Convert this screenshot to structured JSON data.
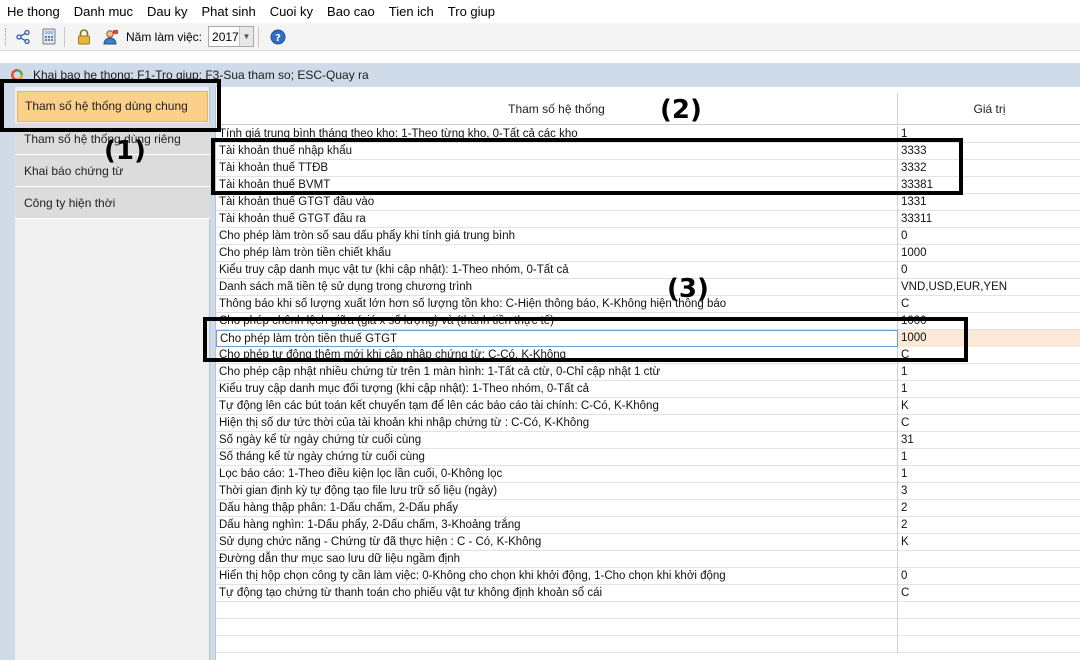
{
  "menu": [
    "He thong",
    "Danh muc",
    "Dau ky",
    "Phat sinh",
    "Cuoi ky",
    "Bao cao",
    "Tien ich",
    "Tro giup"
  ],
  "toolbar": {
    "icons": [
      "share-icon",
      "calculator-icon",
      "lock-icon",
      "user-icon",
      "help-icon"
    ],
    "year_label": "Năm làm việc:",
    "year_value": "2017"
  },
  "window": {
    "title": "Khai bao he thong: F1-Tro giup; F3-Sua tham so; ESC-Quay ra"
  },
  "sidebar": {
    "items": [
      {
        "label": "Tham số hệ thống dùng chung",
        "active": true
      },
      {
        "label": "Tham số hệ thống dùng riêng",
        "active": false
      },
      {
        "label": "Khai báo chứng từ",
        "active": false
      },
      {
        "label": "Công ty hiện thời",
        "active": false
      }
    ]
  },
  "grid": {
    "columns": {
      "name": "Tham số hệ thống",
      "value": "Giá trị"
    },
    "rows": [
      {
        "name": "Tính giá trung bình tháng theo kho: 1-Theo từng kho, 0-Tất cả các kho",
        "value": "1"
      },
      {
        "name": "Tài khoản thuế nhập khẩu",
        "value": "3333"
      },
      {
        "name": "Tài khoản thuế TTĐB",
        "value": "3332"
      },
      {
        "name": "Tài khoản thuế BVMT",
        "value": "33381"
      },
      {
        "name": "Tài khoản thuế GTGT đầu vào",
        "value": "1331"
      },
      {
        "name": "Tài khoản thuế GTGT đầu ra",
        "value": "33311"
      },
      {
        "name": "Cho phép làm tròn số sau dấu phẩy khi tính giá trung bình",
        "value": "0"
      },
      {
        "name": "Cho phép làm tròn tiền chiết khấu",
        "value": "1000"
      },
      {
        "name": "Kiểu truy cập danh mục vật tư (khi cập nhật): 1-Theo nhóm, 0-Tất cả",
        "value": "0"
      },
      {
        "name": "Danh sách mã tiền tệ sử dụng trong chương trình",
        "value": "VND,USD,EUR,YEN"
      },
      {
        "name": "Thông báo khi số lượng xuất lớn hơn số lượng tồn kho: C-Hiện thông báo,   K-Không hiện thông báo",
        "value": "C"
      },
      {
        "name": "Cho phép chênh lệch giữa (giá x số lượng) và (thành tiền thực tế)",
        "value": "1000"
      },
      {
        "name": "Cho phép làm tròn tiền thuế GTGT",
        "value": "1000"
      },
      {
        "name": "Cho phép tự động thêm mới khi cập nhập chứng từ: C-Có, K-Không",
        "value": "C"
      },
      {
        "name": "Cho phép cập nhật nhiều chứng từ trên 1 màn hình: 1-Tất cả ctừ, 0-Chỉ cập nhật 1 ctừ",
        "value": "1"
      },
      {
        "name": "Kiểu truy cập danh mục đối tượng (khi cập nhật): 1-Theo nhóm, 0-Tất cả",
        "value": "1"
      },
      {
        "name": "Tự động lên các bút toán kết chuyển tạm để lên các báo cáo tài chính: C-Có, K-Không",
        "value": "K"
      },
      {
        "name": "Hiện thị số dư tức thời của tài khoản khi  nhập chứng từ : C-Có, K-Không",
        "value": "C"
      },
      {
        "name": "Số ngày kể từ ngày chứng từ cuối cùng",
        "value": "31"
      },
      {
        "name": "Số tháng kể từ ngày chứng từ cuối cùng",
        "value": "1"
      },
      {
        "name": "Lọc báo cáo: 1-Theo điều kiện lọc lần cuối, 0-Không lọc",
        "value": "1"
      },
      {
        "name": "Thời gian định kỳ tự động tạo file lưu trữ số liệu (ngày)",
        "value": "3"
      },
      {
        "name": "Dấu hàng thập phân: 1-Dấu chấm,   2-Dấu phẩy",
        "value": "2"
      },
      {
        "name": "Dấu hàng nghìn: 1-Dấu phẩy,   2-Dấu chấm,   3-Khoảng trắng",
        "value": "2"
      },
      {
        "name": "Sử dụng chức năng - Chứng từ đã thực hiện : C - Có,  K-Không",
        "value": "K"
      },
      {
        "name": "Đường dẫn thư mục sao lưu dữ liệu ngầm định",
        "value": ""
      },
      {
        "name": "Hiển thị hộp chọn công ty cần làm việc: 0-Không cho chọn khi khởi động,  1-Cho chọn khi khởi động",
        "value": "0"
      },
      {
        "name": "Tự động tạo chứng từ thanh toán cho phiếu vật tư không định khoản sổ cái",
        "value": "C"
      }
    ]
  },
  "annotations": [
    "(1)",
    "(2)",
    "(3)"
  ]
}
